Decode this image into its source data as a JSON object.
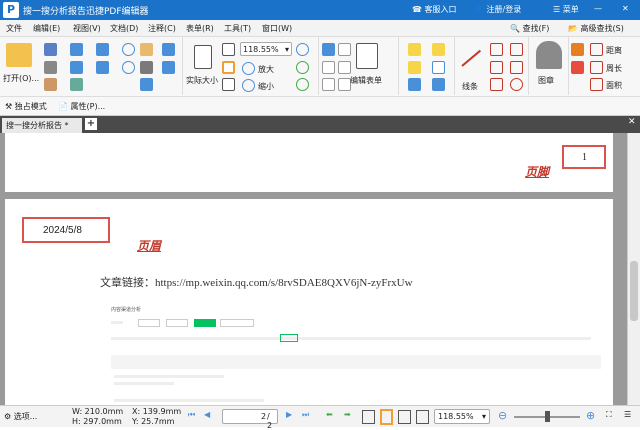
{
  "app": {
    "title": "搜一搜分析报告迅捷PDF编辑器",
    "logo_letter": "P",
    "customer_entry": "客服入口",
    "login": "注册/登录",
    "menu": "菜单"
  },
  "menus": [
    "文件",
    "编辑(E)",
    "视图(V)",
    "文档(D)",
    "注释(C)",
    "表单(R)",
    "工具(T)",
    "窗口(W)"
  ],
  "search_btn": "查找(F)",
  "adv_search_btn": "高级查找(S)",
  "toolbar": {
    "open": "打开(O)...",
    "actual_size": "实际大小",
    "zoom_value": "118.55%",
    "zoom_in": "放大",
    "zoom_out": "缩小",
    "edit_form": "编辑表单",
    "line": "线条",
    "stamp": "图章",
    "distance": "距离",
    "perimeter": "周长",
    "area": "面积",
    "exclusive_mode": "独占模式",
    "properties": "属性(P)..."
  },
  "tab": {
    "label": "搜一搜分析报告 *",
    "add": "+"
  },
  "doc": {
    "page_number": "1",
    "footer_label": "页脚",
    "date": "2024/5/8",
    "header_label": "页眉",
    "link_text": "文章链接：https://mp.weixin.qq.com/s/8rvSDAE8QXV6jN-zyFrxUw",
    "embedded_title": "内容渠道分析"
  },
  "status": {
    "select": "选项...",
    "width": "W: 210.0mm",
    "height": "H: 297.0mm",
    "x": "X: 139.9mm",
    "y": "Y: 25.7mm",
    "page_current": "2",
    "page_total": "/ 2",
    "zoom": "118.55%"
  },
  "colors": {
    "accent": "#1a73c9",
    "annotation_red": "#d9534f",
    "header_red": "#c0392b"
  }
}
